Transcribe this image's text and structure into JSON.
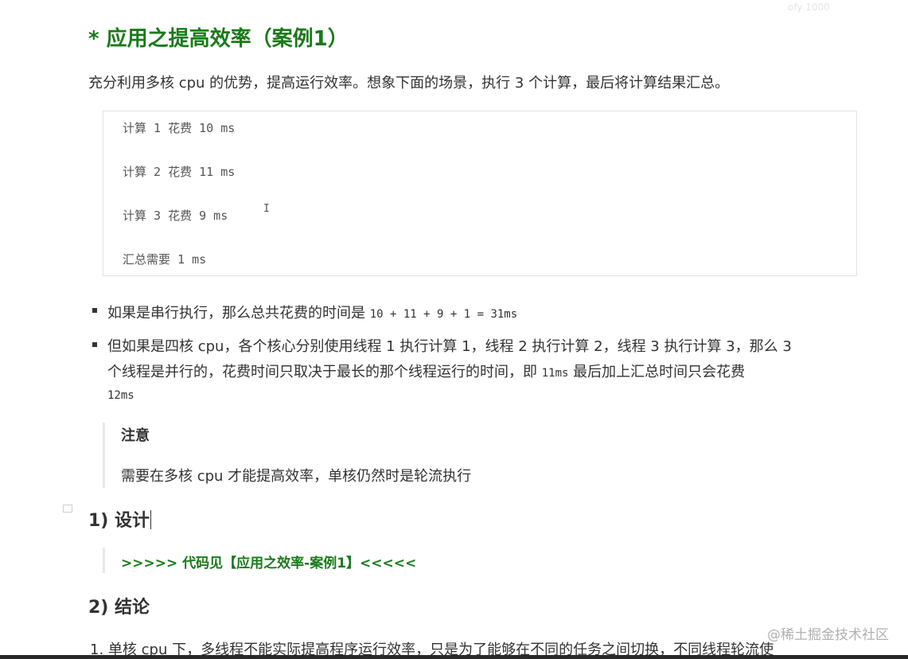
{
  "faint_header": "ofy 1000",
  "heading": "* 应用之提高效率（案例1）",
  "intro": "充分利用多核 cpu 的优势，提高运行效率。想象下面的场景，执行 3 个计算，最后将计算结果汇总。",
  "code_lines": [
    "计算 1 花费 10 ms",
    "计算 2 花费 11 ms",
    "计算 3 花费 9 ms",
    "汇总需要 1 ms"
  ],
  "bullets": {
    "b1_text": "如果是串行执行，那么总共花费的时间是 ",
    "b1_code": "10 + 11 + 9 + 1 = 31ms",
    "b2_line1": "但如果是四核 cpu，各个核心分别使用线程 1 执行计算 1，线程 2 执行计算 2，线程 3 执行计算 3，那么 3",
    "b2_line2_a": "个线程是并行的，花费时间只取决于最长的那个线程运行的时间，即 ",
    "b2_line2_code": "11ms",
    "b2_line2_b": " 最后加上汇总时间只会花费",
    "b2_line3_code": "12ms"
  },
  "note": {
    "title": "注意",
    "body": "需要在多核 cpu 才能提高效率，单核仍然时是轮流执行"
  },
  "section1": {
    "title": "1) 设计",
    "link": ">>>>> 代码见【应用之效率-案例1】<<<<<"
  },
  "section2": {
    "title": "2) 结论",
    "item1": "1. 单核 cpu 下，多线程不能实际提高程序运行效率，只是为了能够在不同的任务之间切换，不同线程轮流使"
  },
  "watermark": "@稀土掘金技术社区",
  "colors": {
    "heading_green": "#1a7a1a",
    "text": "#333333"
  }
}
